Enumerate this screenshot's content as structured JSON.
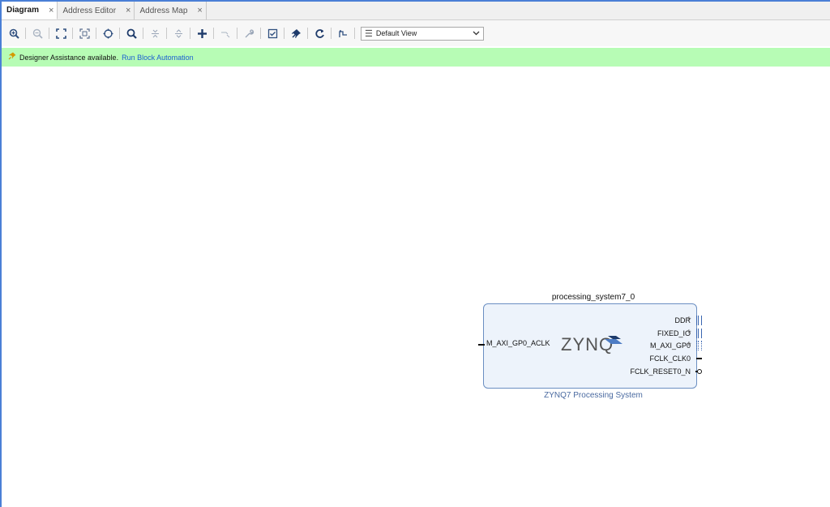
{
  "tabs": [
    {
      "label": "Diagram",
      "active": true
    },
    {
      "label": "Address Editor",
      "active": false
    },
    {
      "label": "Address Map",
      "active": false
    }
  ],
  "tab_close_glyph": "×",
  "toolbar": {
    "buttons": [
      {
        "name": "zoom-in-icon"
      },
      {
        "name": "zoom-out-icon"
      },
      {
        "name": "fit-full-icon"
      },
      {
        "name": "fit-selection-icon"
      },
      {
        "name": "auto-fit-icon"
      },
      {
        "name": "search-icon"
      },
      {
        "name": "collapse-icon"
      },
      {
        "name": "expand-icon"
      },
      {
        "name": "add-ip-icon"
      },
      {
        "name": "make-external-icon"
      },
      {
        "name": "customize-icon"
      },
      {
        "name": "validate-icon"
      },
      {
        "name": "pin-icon"
      },
      {
        "name": "regenerate-layout-icon"
      },
      {
        "name": "optimize-routing-icon"
      }
    ],
    "view_select": "Default View"
  },
  "banner": {
    "message": "Designer Assistance available.",
    "link": "Run Block Automation"
  },
  "block": {
    "instance_name": "processing_system7_0",
    "subtitle": "ZYNQ7 Processing System",
    "logo_text": "ZYNQ",
    "left_ports": [
      "M_AXI_GP0_ACLK"
    ],
    "right_ports": [
      "DDR",
      "FIXED_IO",
      "M_AXI_GP0",
      "FCLK_CLK0",
      "FCLK_RESET0_N"
    ]
  },
  "colors": {
    "accent": "#4a7fd6",
    "banner_bg": "#b7fcb5",
    "link": "#1c5fd1",
    "block_fill": "#edf3fb",
    "block_border": "#6b8fc2"
  }
}
